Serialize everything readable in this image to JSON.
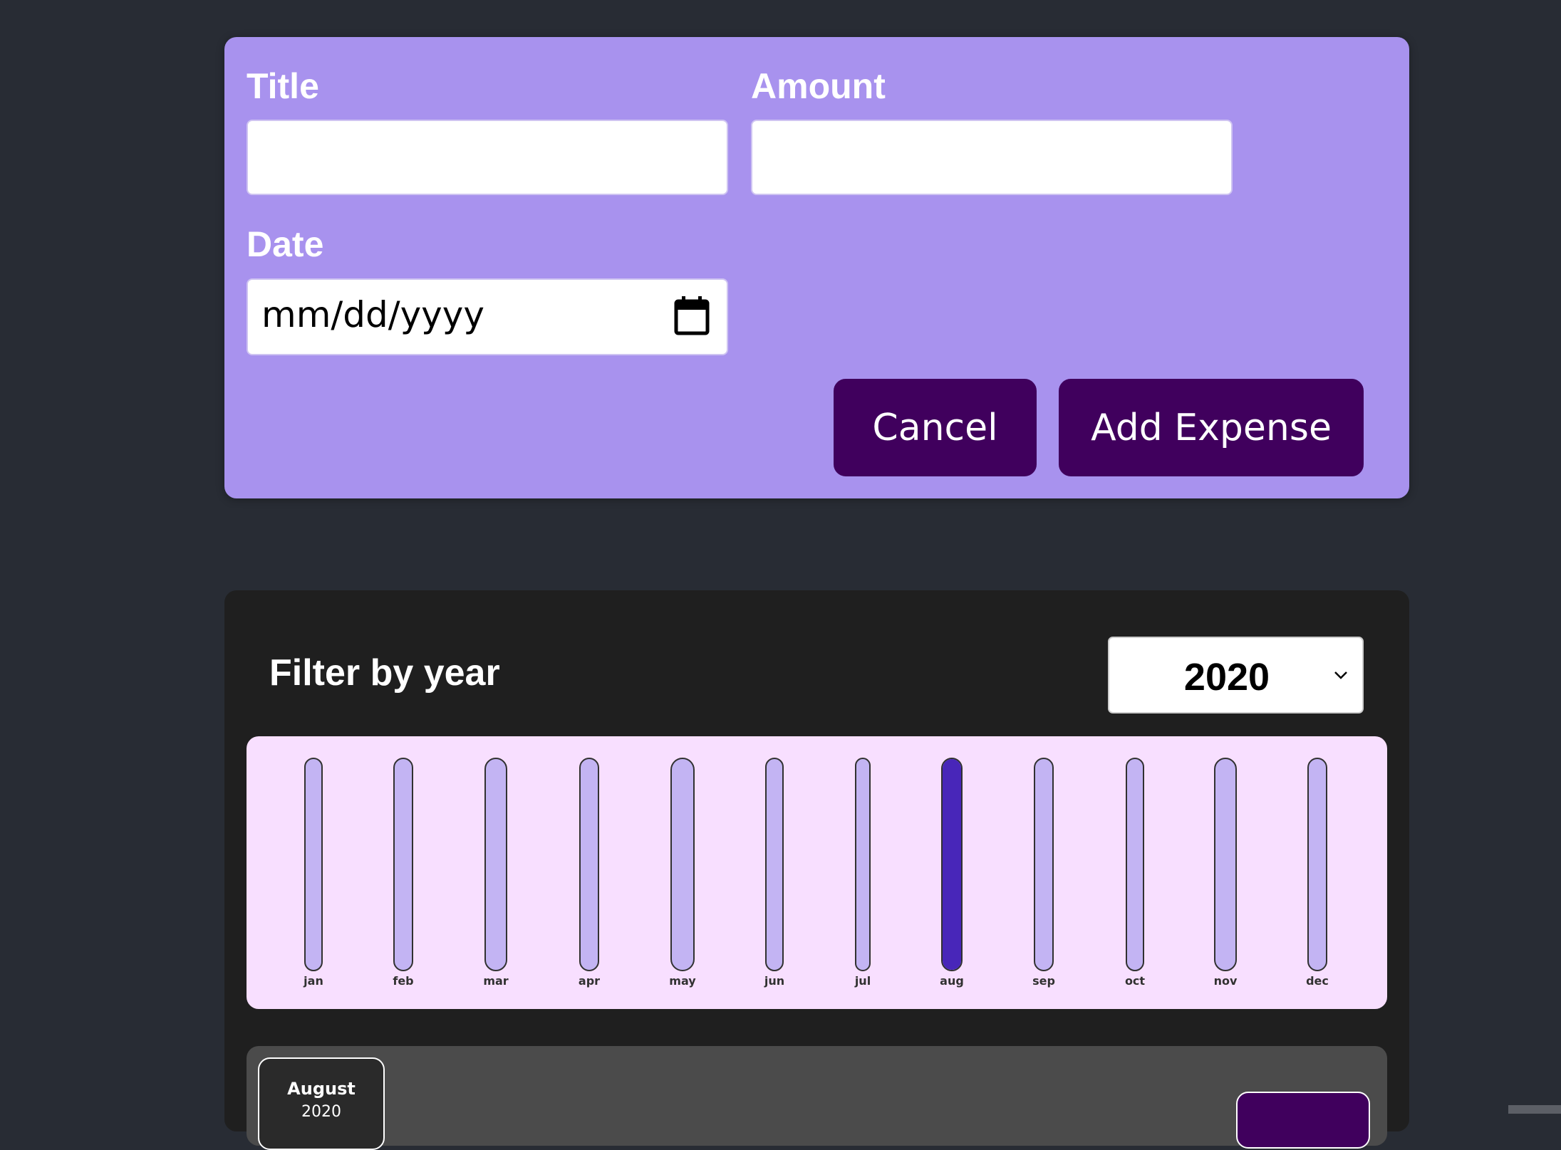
{
  "form": {
    "title_label": "Title",
    "title_value": "",
    "amount_label": "Amount",
    "amount_value": "",
    "date_label": "Date",
    "date_placeholder": "mm/dd/yyyy",
    "cancel_label": "Cancel",
    "submit_label": "Add Expense"
  },
  "filter": {
    "label": "Filter by year",
    "selected_year": "2020"
  },
  "chart_data": {
    "type": "bar",
    "categories": [
      "jan",
      "feb",
      "mar",
      "apr",
      "may",
      "jun",
      "jul",
      "aug",
      "sep",
      "oct",
      "nov",
      "dec"
    ],
    "values": [
      0,
      0,
      0,
      0,
      0,
      0,
      0,
      1,
      0,
      0,
      0,
      0
    ],
    "ylim": [
      0,
      1
    ],
    "grid": false
  },
  "expense_item": {
    "month": "August",
    "year": "2020"
  },
  "colors": {
    "background": "#282c34",
    "form_card": "#a892ee",
    "button": "#40005d",
    "expenses_card": "#1f1f1f",
    "chart_bg": "#f8dfff",
    "bar_empty": "#c3b4f3",
    "bar_fill": "#4826b9"
  }
}
